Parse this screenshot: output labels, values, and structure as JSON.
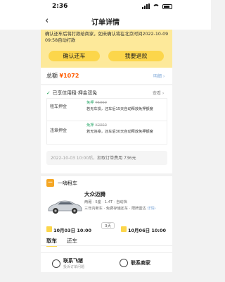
{
  "status": {
    "time": "2:36"
  },
  "nav": {
    "back_glyph": "‹",
    "title": "订单详情"
  },
  "banner": {
    "notice": "确认还车后将打款给商家，如未确认将在北京时间2022-10-09 09:58自动打款",
    "confirm_label": "确认还车",
    "refund_label": "我要退款"
  },
  "summary": {
    "total_label": "总额",
    "total_value": "¥1072",
    "detail_link": "明细 ›"
  },
  "deposit": {
    "check_glyph": "✓",
    "title": "已享信用租·押金双免",
    "view_link": "查看 ›",
    "rows": [
      {
        "label": "租车押金",
        "status": "免押",
        "amount": "¥5000",
        "desc": "若无车损，还车后15天自动释放免押额度"
      },
      {
        "label": "违章押金",
        "status": "免押",
        "amount": "¥2000",
        "desc": "若无违章，还车后30天自动释放免押额度"
      }
    ],
    "free_note_date": "2022-10-03 10:00后，",
    "free_note_text": "扣取订单费用 736元"
  },
  "vendor": {
    "logo_text": "一",
    "name": "一嗨租车"
  },
  "car": {
    "name": "大众迈腾",
    "specs": "两厢 · 5座 · 1.4T · 自动挡",
    "features": "三年内新车 · 免费存储还车 · 限牌雷达",
    "features_link": "详情›"
  },
  "rental": {
    "pickup": "10月03日 10:00",
    "days": "3天",
    "return": "10月06日 10:00"
  },
  "tabs": [
    "取车",
    "还车"
  ],
  "bottom": {
    "left_label": "联系飞猪",
    "left_sub": "投诉订单问题",
    "right_label": "联系商家"
  },
  "colors": {
    "accent": "#fcd64b",
    "price": "#ff5b00",
    "green": "#1fa463"
  }
}
